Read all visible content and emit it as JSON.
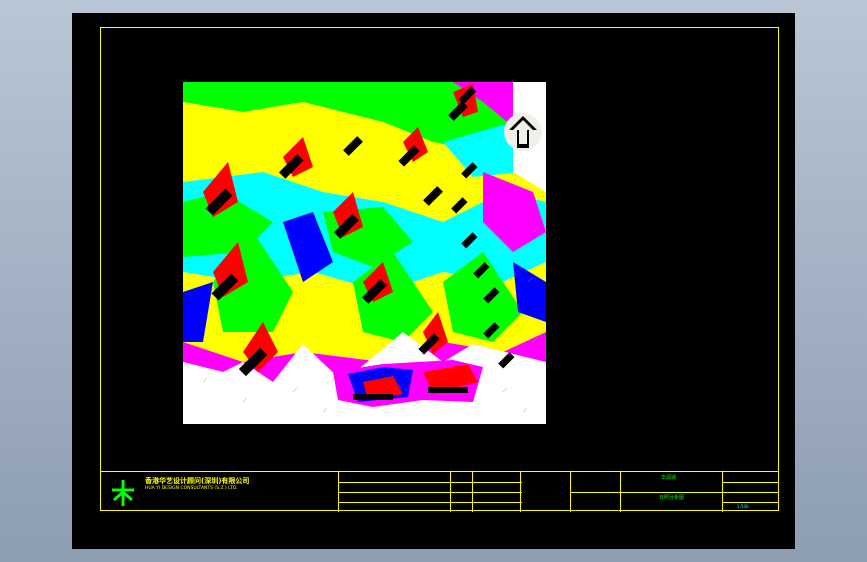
{
  "company": {
    "name_cn": "香港华艺设计顾问(深圳)有限公司",
    "name_en": "HUA YI DESIGN CONSULTANTS (S.Z.) LTD."
  },
  "title_block": {
    "project_name": "华润城",
    "drawing_name": "日照分析图",
    "scale": "1:500"
  },
  "colors": {
    "background": "#000000",
    "frame": "#ffff00",
    "accent_text": "#00ff00",
    "analysis_palette": [
      "#00ff00",
      "#ffff00",
      "#00ffff",
      "#0000ff",
      "#ff00ff",
      "#ff0000"
    ]
  },
  "icons": [
    "north-arrow-icon",
    "company-logo-icon"
  ]
}
